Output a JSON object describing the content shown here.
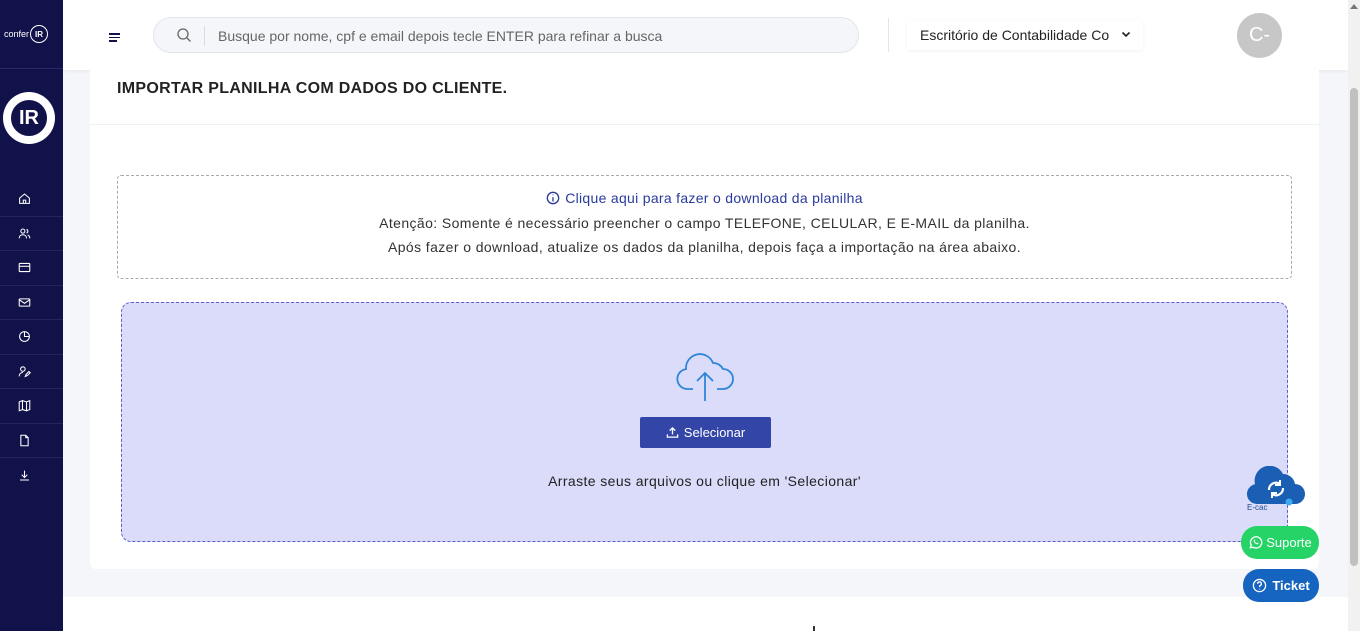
{
  "sidebar": {
    "brand_small": "confer",
    "brand_small_mark": "IR",
    "logo_mark": "IR",
    "items": [
      {
        "icon": "home-icon"
      },
      {
        "icon": "users-icon"
      },
      {
        "icon": "card-icon"
      },
      {
        "icon": "mail-icon"
      },
      {
        "icon": "pie-chart-icon"
      },
      {
        "icon": "user-edit-icon"
      },
      {
        "icon": "book-icon"
      },
      {
        "icon": "document-icon"
      },
      {
        "icon": "download-icon"
      }
    ]
  },
  "topbar": {
    "search_placeholder": "Busque por nome, cpf e email depois tecle ENTER para refinar a busca",
    "office_selected": "Escritório de Contabilidade Co",
    "avatar_initials": "C-"
  },
  "card": {
    "title": "IMPORTAR PLANILHA COM DADOS DO CLIENTE.",
    "info_link": "Clique aqui para fazer o download da planilha",
    "info_line1": "Atenção: Somente é necessário preencher o campo TELEFONE, CELULAR, E E-MAIL da planilha.",
    "info_line2": "Após fazer o download, atualize os dados da planilha, depois faça a importação na área abaixo.",
    "select_label": "Selecionar",
    "drop_text": "Arraste seus arquivos ou clique em 'Selecionar'"
  },
  "widgets": {
    "ecac_label": "E-cac",
    "suporte_label": "Suporte",
    "ticket_label": "Ticket"
  },
  "colors": {
    "sidebar_bg": "#12124a",
    "primary_button": "#3346a8",
    "dropzone_bg": "#dadcfa",
    "whatsapp": "#25d366",
    "ticket": "#1565c0"
  }
}
